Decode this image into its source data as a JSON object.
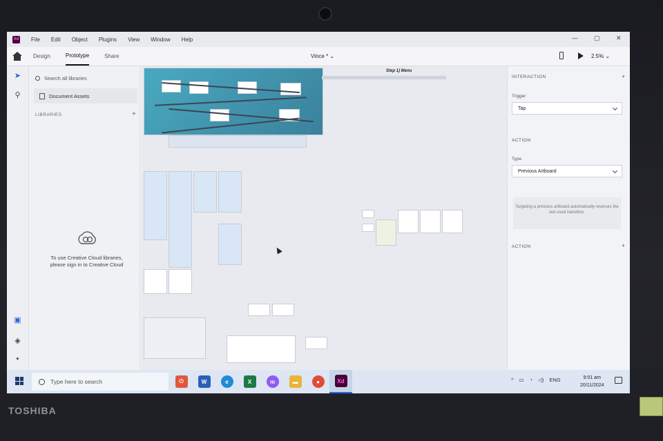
{
  "device": {
    "brand": "TOSHIBA"
  },
  "app": {
    "logo": "Xd",
    "icon": "adobe-xd-icon"
  },
  "menu": [
    "File",
    "Edit",
    "Object",
    "Plugins",
    "View",
    "Window",
    "Help"
  ],
  "window_controls": {
    "minimize": "—",
    "maximize": "▢",
    "close": "✕"
  },
  "tabs": [
    {
      "label": "Design",
      "active": false
    },
    {
      "label": "Prototype",
      "active": true
    },
    {
      "label": "Share",
      "active": false
    }
  ],
  "document_title": "Vince *",
  "zoom": "2.5%",
  "libraries": {
    "search_placeholder": "Search all libraries",
    "document_assets": "Document Assets",
    "section_title": "LIBRARIES",
    "add": "+",
    "cc_message": "To use Creative Cloud libraries,\nplease sign in to Creative Cloud"
  },
  "canvas": {
    "flow_title": "Step 1) Menu"
  },
  "interaction_panel": {
    "section": "INTERACTION",
    "add": "+",
    "trigger_label": "Trigger",
    "trigger_value": "Tap",
    "action_section": "ACTION",
    "type_label": "Type",
    "type_value": "Previous Artboard",
    "note": "Targeting a previous artboard automatically reverses the last used transition.",
    "action2_section": "ACTION",
    "action2_add": "+"
  },
  "taskbar": {
    "search_placeholder": "Type here to search",
    "apps": [
      {
        "name": "app-red-icon",
        "color": "#e0573a",
        "label": "⏻"
      },
      {
        "name": "word-icon",
        "color": "#2b5fb8",
        "label": "W"
      },
      {
        "name": "edge-icon",
        "color": "#1f8bd6",
        "label": "e"
      },
      {
        "name": "excel-icon",
        "color": "#1d7a45",
        "label": "X"
      },
      {
        "name": "messenger-icon",
        "color": "#8f5bf0",
        "label": "m"
      },
      {
        "name": "file-explorer-icon",
        "color": "#e9b43a",
        "label": "▬"
      },
      {
        "name": "chrome-icon",
        "color": "#e04b3a",
        "label": "●"
      },
      {
        "name": "adobe-xd-icon",
        "color": "#470137",
        "label": "Xd"
      }
    ],
    "tray_language": "ENG",
    "time": "9:01 am",
    "date": "20/11/2024"
  }
}
